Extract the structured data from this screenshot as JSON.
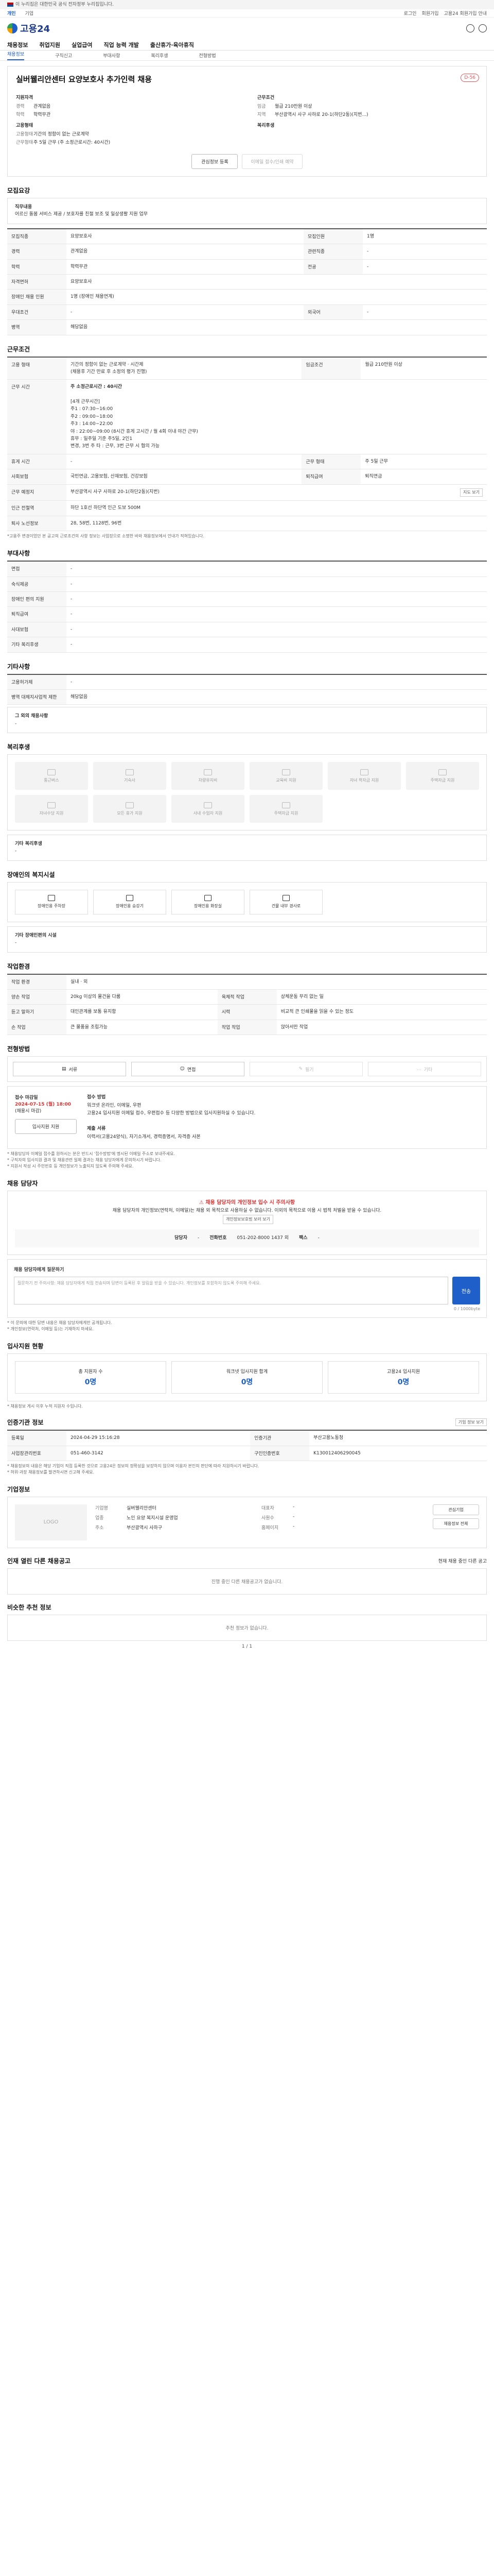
{
  "gov": {
    "text": "이 누리집은 대한민국 공식 전자정부 누리집입니다."
  },
  "topbar": {
    "tabs": [
      "개인",
      "기업"
    ],
    "right": [
      "로그인",
      "회원가입",
      "고용24 회원가입 안내"
    ]
  },
  "header": {
    "logo": "고용24"
  },
  "gnb": [
    "채용정보",
    "취업지원",
    "실업급여",
    "직업 능력 개발",
    "출산휴가·육아휴직"
  ],
  "subnav": [
    "채용정보",
    "구직신고",
    "부대사항",
    "복리후생",
    "전형방법"
  ],
  "job": {
    "title": "실버웰리안센터 요양보호사 추가인력 채용",
    "dday": "D-56",
    "left_label": "지원자격",
    "right_label": "근무조건",
    "career_k": "경력",
    "career_v": "관계없음",
    "edu_k": "학력",
    "edu_v": "학력무관",
    "wage_k": "임금",
    "wage_v": "월급 210만원 이상",
    "region_k": "지역",
    "region_v": "부산광역시 사구 사하로 20-1(하단2동)(지번...)",
    "form_label": "고용형태",
    "form_k": "고용형태",
    "form_v": "기간의 정함이 없는 근로계약",
    "hours_k": "근무형태",
    "hours_v": "주 5일 근무 (주 소정근로시간: 40시간)",
    "welfare_label": "복리후생",
    "btn_scrap": "관심정보 등록",
    "btn_apply": "이메일 접수/인쇄 예약"
  },
  "recruit": {
    "title": "모집요강",
    "duty_k": "직무내용",
    "duty_v": "어르신 돌봄 서비스 제공 / 보호자를 친절 보조 및 일상생활 지원 업무",
    "rows": [
      [
        "모집직종",
        "요양보호사",
        "모집인원",
        "1명"
      ],
      [
        "경력",
        "관계없음",
        "관련직종",
        "-"
      ],
      [
        "학력",
        "학력무관",
        "전공",
        "-"
      ],
      [
        "자격면허",
        "요양보호사",
        "",
        ""
      ],
      [
        "우대조건",
        "-",
        "",
        ""
      ],
      [
        "장애인채용",
        "-",
        "",
        ""
      ]
    ],
    "left_cnt": "1명",
    "near_k": "장애인 채용 인원",
    "near_v": "1명 (장애인 채용연계)",
    "lic_k": "관련 자격",
    "lic_v": "-",
    "pref_k": "우대조건",
    "pref_v": "-",
    "lang_k": "외국어",
    "lang_v": "-",
    "army_k": "병역",
    "army_v": "해당없음"
  },
  "work": {
    "title": "근무조건",
    "type_k": "고용 형태",
    "type_v": "기간의 정함이 없는 근로계약 · 시간제",
    "type_v2": "(채용후 기간 만료 후 소정의 평가 진행)",
    "wage_k": "임금조건",
    "wage_v": "월급 210만원 이상",
    "sched_k": "근무 시간",
    "sched_head": "주 소정근로시간 : 40시간",
    "sched_detail": [
      "[4개 근무시간]",
      "주1 : 07:30~16:00",
      "주2 : 09:00~18:00",
      "주3 : 14:00~22:00",
      "야 : 22:00~09:00 (8시간 휴게 고시간 / 월 4회 이내 야간 근무)",
      "휴무 : 일주일 기준 주5일, 2인1",
      "변경, 3번 주 타 : 근무, 3번 근무 시 협의 가능"
    ],
    "rows": [
      [
        "휴게 시간",
        "-",
        "근무 형태",
        "주 5일 근무"
      ],
      [
        "사회보험",
        "국민연금, 고용보험, 산재보험, 건강보험",
        "퇴직급여",
        "퇴직연금"
      ],
      [
        "근무 예정지",
        "부산광역시 사구 사하로 20-1(하단2동)(지번)",
        "",
        ""
      ],
      [
        "인근 전철역",
        "하단 1호선 하단역 인근 도보 500M",
        "",
        ""
      ],
      [
        "퇴사 노선정보",
        "28, 58번, 1128번, 96번",
        "",
        ""
      ]
    ],
    "map_btn": "지도 보기",
    "note": "*고용주 변경이었던 본 공고의 근로조건의 사항 정보는 사업장으로 소명한 바와 채용정보에서 안내가 적혀있습니다."
  },
  "extra": {
    "title": "부대사항",
    "rows": [
      [
        "면접",
        "-"
      ],
      [
        "숙식제공",
        "-"
      ],
      [
        "장애인 편의 지원",
        "-"
      ],
      [
        "퇴직급여",
        "-"
      ],
      [
        "사대보험",
        "-"
      ],
      [
        "기타 복리후생",
        "-"
      ]
    ]
  },
  "other": {
    "title": "기타사항",
    "rows": [
      [
        "고용허가제",
        "-"
      ],
      [
        "병역 대체지사업적 제한",
        "해당없음"
      ]
    ],
    "etc_label": "그 외의 채용사항",
    "etc_v": "-"
  },
  "welfare": {
    "title": "복리후생",
    "items": [
      "통근버스",
      "기숙사",
      "차량유지비",
      "교육비 지원",
      "자녀 학자금 지원",
      "주택자금 지원",
      "자녀수당 지원",
      "모든 휴가 지원",
      "사내 수업자 지원",
      "주택자금 지원"
    ],
    "note_k": "기타 복리후생",
    "note_v": "-"
  },
  "disabled": {
    "title": "장애인의 복지시설",
    "items": [
      "장애인용 주차장",
      "장애인용 승강기",
      "장애인용 화장실",
      "건물 내부 경사로",
      "",
      ""
    ],
    "note_k": "기타 장애인편의 시설",
    "note_v": "-"
  },
  "process": {
    "title": "작업환경",
    "rows": [
      [
        "작업 환경",
        "실내 · 외",
        "",
        ""
      ],
      [
        "양손 작업",
        "20kg 이상의 물건을 다룸",
        "육체적 작업",
        "상체운동 무리 없는 일"
      ],
      [
        "듣고 말하기",
        "대인관계를 보통 유지함",
        "시력",
        "비교적 큰 인쇄물을 읽을 수 있는 정도"
      ],
      [
        "손 작업",
        "큰 물품을 조립가능",
        "작업 작업",
        "앉아서만 작업"
      ]
    ]
  },
  "method": {
    "title": "전형방법",
    "items": [
      "서류",
      "면접",
      "필기",
      "기타"
    ],
    "off": [
      false,
      false,
      true,
      true
    ],
    "deadline_label": "접수 마감일",
    "deadline_v": "2024-07-15 (월) 18:00",
    "deadline_sub": "(채용시 마감)",
    "apply_way_k": "접수 방법",
    "apply_way_v": "워크넷 온라인, 이메일, 우편",
    "apply_way_d": "고용24 입사지원 이메일 접수, 우편접수 등 다양한 방법으로 입사지원하실 수 있습니다.",
    "docs_k": "제출 서류",
    "docs_v": "이력서(고용24양식), 자기소개서, 경력증명서, 자격증 사본",
    "btn": "입사지원 지원",
    "notes": [
      "* 채용담당자 이메일 접수를 원하시는 분은 반드시 '접수방법'에 명시된 이메일 주소로 보내주세요.",
      "* 구직자의 입사지원 결과 및 채용관련 일체 결과는 채용 담당자에게 문의하시기 바랍니다.",
      "* 지원서 작성 시 주민번호 등 개인정보가 노출되지 않도록 주의해 주세요."
    ]
  },
  "contact": {
    "title": "채용 담당자",
    "warn": "채용 담당자의 개인정보 입수 시 주의사항",
    "guide": "채용 담당자의 개인정보(연락처, 이메일)는 채용 외 목적으로 사용하실 수 없습니다. 이외의 목적으로 이용 시 법적 처벌을 받을 수 있습니다.",
    "guide_btn": "개인정보보호법 보러 보기",
    "mgr_k": "담당자",
    "mgr_v": "-",
    "tel_k": "전화번호",
    "tel_v": "051-202-8000 1437 외",
    "fax_k": "팩스",
    "fax_v": "-",
    "qa_label": "채용 담당자에게 질문하기",
    "qa_ph": "질문하기 전 주의사항: 채용 담당자에게 직접 전송되며 답변이 등록된 후 알림을 받을 수 있습니다. 개인정보를 포함하지 않도록 주의해 주세요.",
    "qa_cnt": "0 / 1000byte",
    "qa_send": "전송",
    "qa_notes": [
      "* 이 문의에 대한 답변 내용은 채용 담당자에게만 공개됩니다.",
      "* 개인정보(연락처, 이메일 등)는 기재하지 마세요."
    ]
  },
  "stats": {
    "title": "입사지원 현황",
    "items": [
      [
        "총 지원자 수",
        "0명"
      ],
      [
        "워크넷 입사지원 합계",
        "0명"
      ],
      [
        "고용24 입사지원",
        "0명"
      ]
    ],
    "note": "* 채용정보 게시 이후 누적 지원자 수입니다."
  },
  "meta": {
    "title": "인증기관 정보",
    "btn": "기업 정보 보기",
    "rows": [
      [
        "등록일",
        "2024-04-29 15:16:28",
        "인증기관",
        "부산고용노동청"
      ],
      [
        "사업장관리번호",
        "051-460-3142",
        "구인인증번호",
        "K130012406290045"
      ]
    ],
    "notes": [
      "* 채용정보의 내용은 해당 기업이 직접 등록한 것으로 고용24은 정보의 정확성을 보장하지 않으며 이용자 본인의 판단에 따라 지원하시기 바랍니다.",
      "* 허위·과장 채용정보를 발견하시면 신고해 주세요."
    ]
  },
  "corp": {
    "title": "기업정보",
    "logo": "LOGO",
    "k1": "기업명",
    "v1": "실버웰리안센터",
    "k2": "업종",
    "v2": "노인 요양 복지시설 운영업",
    "k3": "대표자",
    "v3": "-",
    "k4": "사원수",
    "v4": "-",
    "k5": "주소",
    "v5": "부산광역시 사하구",
    "k6": "홈페이지",
    "v6": "-",
    "btns": [
      "관심기업",
      "채용정보 전체"
    ]
  },
  "others": {
    "title": "인재 열린 다른 채용공고",
    "sub": "현재 채용 중인 다른 공고",
    "empty": "진행 중인 다른 채용공고가 없습니다."
  },
  "recommend": {
    "title": "비슷한 추천 정보",
    "empty": "추천 정보가 없습니다.",
    "pager": "1 / 1"
  }
}
